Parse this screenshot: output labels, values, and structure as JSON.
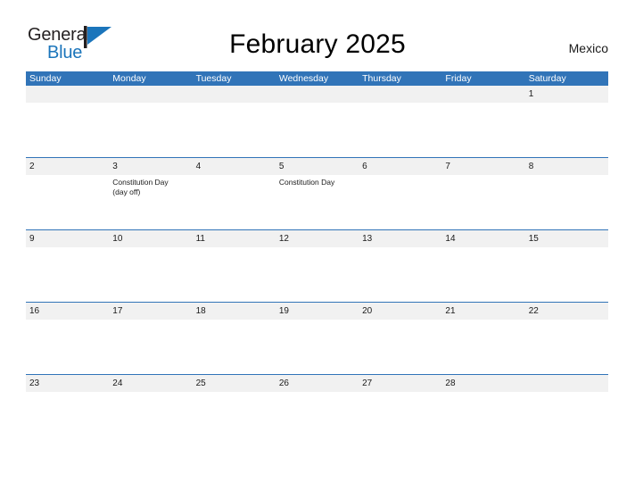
{
  "brand": {
    "word_one": "General",
    "word_two": "Blue",
    "mark_name": "blue-triangle-flag",
    "color_dark": "#231f20",
    "color_blue": "#1b75bb"
  },
  "header": {
    "title": "February 2025",
    "country": "Mexico"
  },
  "theme": {
    "header_blue": "#3174b8",
    "daynum_band_gray": "#f1f1f1",
    "separator_blue": "#3174b8"
  },
  "calendar": {
    "weekdays": [
      "Sunday",
      "Monday",
      "Tuesday",
      "Wednesday",
      "Thursday",
      "Friday",
      "Saturday"
    ],
    "weeks": [
      {
        "days": [
          {
            "num": "",
            "events": []
          },
          {
            "num": "",
            "events": []
          },
          {
            "num": "",
            "events": []
          },
          {
            "num": "",
            "events": []
          },
          {
            "num": "",
            "events": []
          },
          {
            "num": "",
            "events": []
          },
          {
            "num": "1",
            "events": []
          }
        ]
      },
      {
        "days": [
          {
            "num": "2",
            "events": []
          },
          {
            "num": "3",
            "events": [
              "Constitution Day",
              "(day off)"
            ]
          },
          {
            "num": "4",
            "events": []
          },
          {
            "num": "5",
            "events": [
              "Constitution Day"
            ]
          },
          {
            "num": "6",
            "events": []
          },
          {
            "num": "7",
            "events": []
          },
          {
            "num": "8",
            "events": []
          }
        ]
      },
      {
        "days": [
          {
            "num": "9",
            "events": []
          },
          {
            "num": "10",
            "events": []
          },
          {
            "num": "11",
            "events": []
          },
          {
            "num": "12",
            "events": []
          },
          {
            "num": "13",
            "events": []
          },
          {
            "num": "14",
            "events": []
          },
          {
            "num": "15",
            "events": []
          }
        ]
      },
      {
        "days": [
          {
            "num": "16",
            "events": []
          },
          {
            "num": "17",
            "events": []
          },
          {
            "num": "18",
            "events": []
          },
          {
            "num": "19",
            "events": []
          },
          {
            "num": "20",
            "events": []
          },
          {
            "num": "21",
            "events": []
          },
          {
            "num": "22",
            "events": []
          }
        ]
      },
      {
        "days": [
          {
            "num": "23",
            "events": []
          },
          {
            "num": "24",
            "events": []
          },
          {
            "num": "25",
            "events": []
          },
          {
            "num": "26",
            "events": []
          },
          {
            "num": "27",
            "events": []
          },
          {
            "num": "28",
            "events": []
          },
          {
            "num": "",
            "events": []
          }
        ]
      }
    ]
  }
}
